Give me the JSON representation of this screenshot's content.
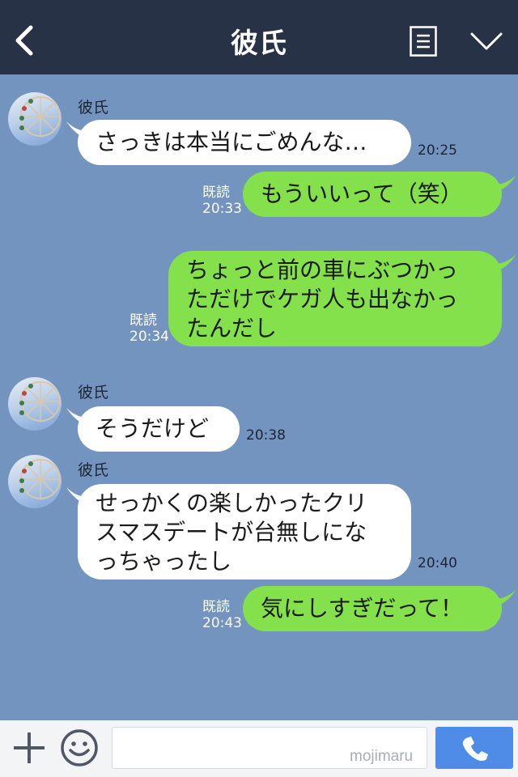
{
  "header": {
    "title": "彼氏",
    "back_icon": "chevron-left-icon",
    "menu_icon": "menu-list-icon",
    "collapse_icon": "chevron-down-icon",
    "background": "#273246"
  },
  "chat": {
    "background": "#7494c0",
    "messages": [
      {
        "side": "in",
        "sender": "彼氏",
        "text": "さっきは本当にごめんな…",
        "time": "20:25"
      },
      {
        "side": "out",
        "read": "既読",
        "time": "20:33",
        "text": "もういいって（笑）"
      },
      {
        "side": "out",
        "read": "既読",
        "time": "20:34",
        "text": "ちょっと前の車にぶつかっ\nただけでケガ人も出なかっ\nたんだし"
      },
      {
        "side": "in",
        "sender": "彼氏",
        "text": "そうだけど",
        "time": "20:38"
      },
      {
        "side": "in",
        "sender": "彼氏",
        "text": "せっかくの楽しかったクリ\nスマスデートが台無しにな\nっちゃったし",
        "time": "20:40"
      },
      {
        "side": "out",
        "read": "既読",
        "time": "20:43",
        "text": "気にしすぎだって！"
      }
    ],
    "colors": {
      "incoming": "#ffffff",
      "outgoing": "#84e14b"
    }
  },
  "input_bar": {
    "plus_icon": "plus-icon",
    "emoji_icon": "smile-icon",
    "input_value": "",
    "watermark": "mojimaru",
    "call_icon": "phone-icon",
    "call_color": "#4f8ce7"
  }
}
